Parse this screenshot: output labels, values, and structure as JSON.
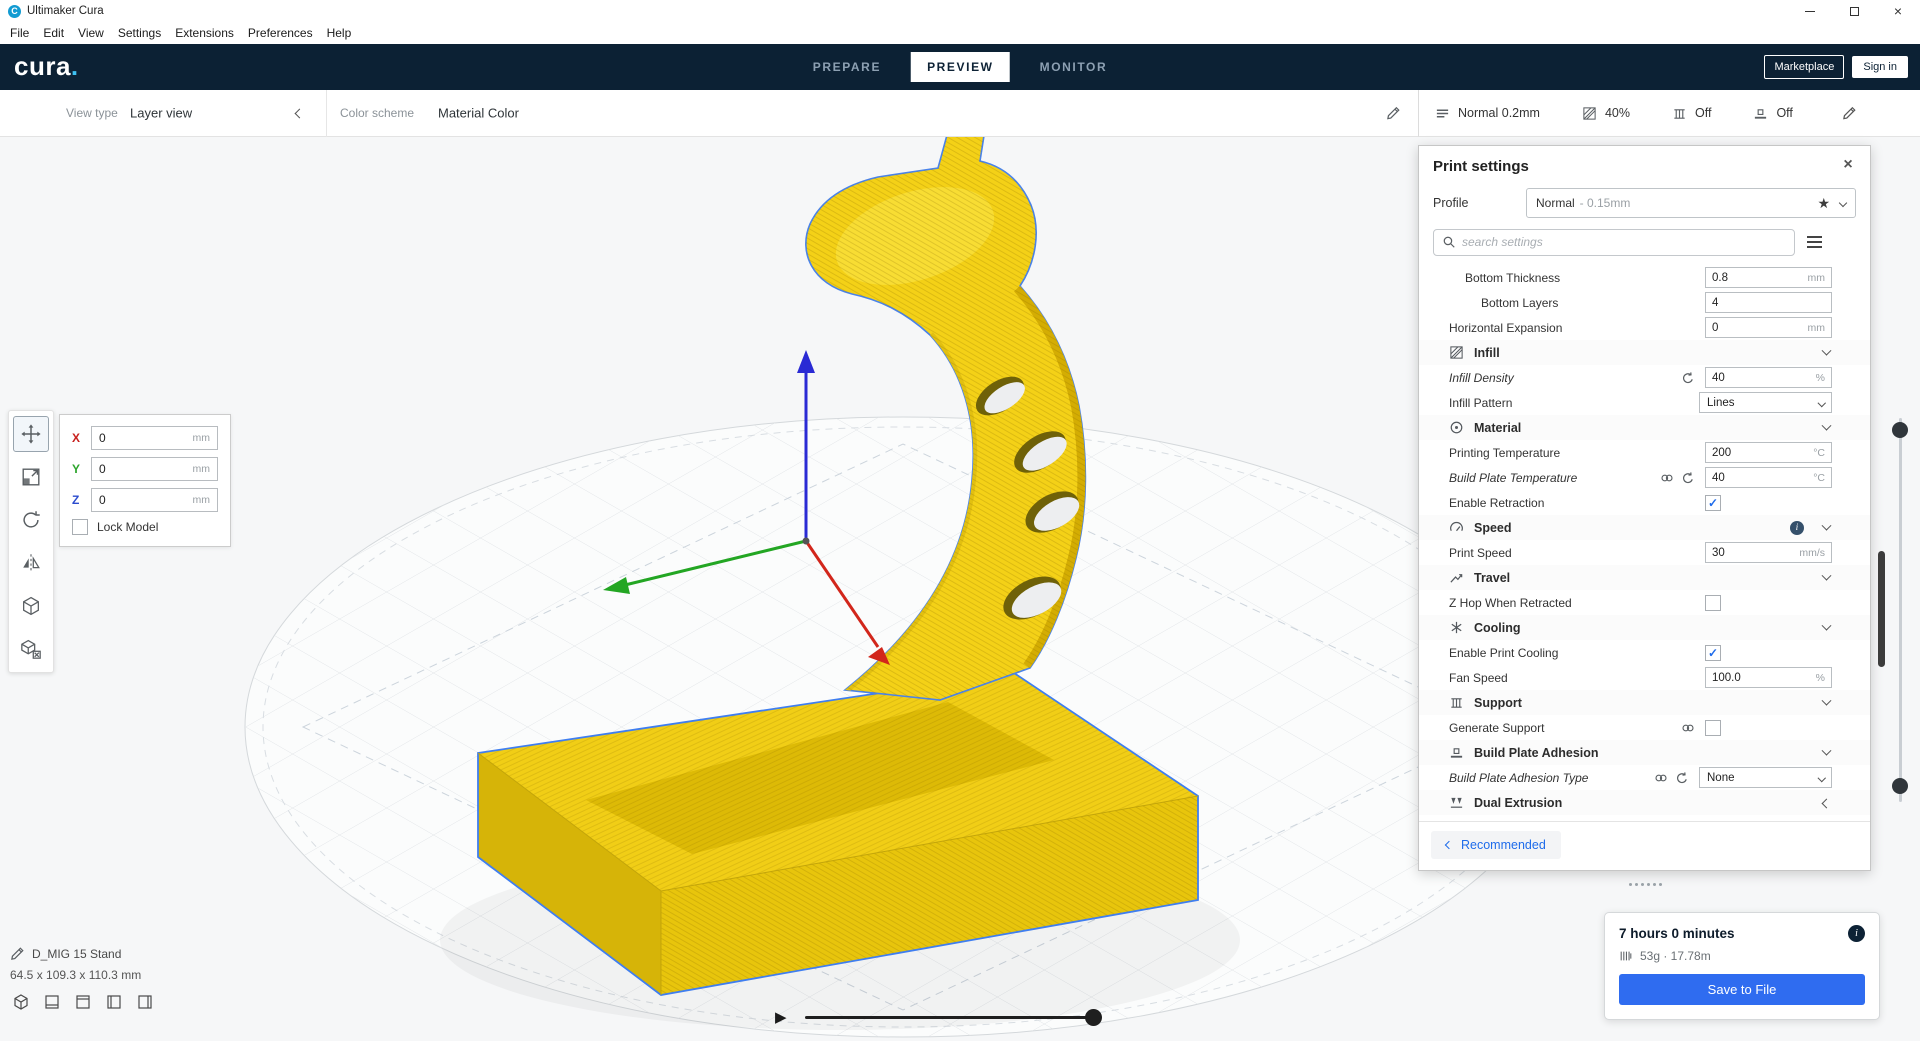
{
  "window": {
    "title": "Ultimaker Cura"
  },
  "glyphs": {
    "close": "×",
    "star": "★",
    "check": "✓",
    "app_initial": "C"
  },
  "menu": {
    "items": [
      "File",
      "Edit",
      "View",
      "Settings",
      "Extensions",
      "Preferences",
      "Help"
    ]
  },
  "header": {
    "logo": "cura",
    "logo_dot": ".",
    "tabs": [
      {
        "label": "PREPARE",
        "active": false
      },
      {
        "label": "PREVIEW",
        "active": true
      },
      {
        "label": "MONITOR",
        "active": false
      }
    ],
    "marketplace_label": "Marketplace",
    "sign_in_label": "Sign in"
  },
  "stage_header": {
    "view_type_label": "View type",
    "view_type_value": "Layer view",
    "color_scheme_label": "Color scheme",
    "color_scheme_value": "Material Color"
  },
  "settings_summary": {
    "items": [
      {
        "name": "profile",
        "icon": "layers",
        "text": "Normal 0.2mm"
      },
      {
        "name": "infill",
        "icon": "infill",
        "text": "40%"
      },
      {
        "name": "support",
        "icon": "support",
        "text": "Off"
      },
      {
        "name": "adhesion",
        "icon": "adhesion",
        "text": "Off"
      }
    ]
  },
  "print_settings": {
    "title": "Print settings",
    "profile_label": "Profile",
    "profile_value": "Normal",
    "profile_suffix": "- 0.15mm",
    "search_placeholder": "search settings",
    "footer_label": "Recommended",
    "rows": [
      {
        "type": "setting",
        "label": "Bottom Thickness",
        "indent": 1,
        "control": "number",
        "value": "0.8",
        "unit": "mm"
      },
      {
        "type": "setting",
        "label": "Bottom Layers",
        "indent": 2,
        "control": "number",
        "value": "4",
        "unit": ""
      },
      {
        "type": "setting",
        "label": "Horizontal Expansion",
        "indent": 0,
        "control": "number",
        "value": "0",
        "unit": "mm"
      },
      {
        "type": "category",
        "label": "Infill",
        "icon": "infill",
        "chevron": "down"
      },
      {
        "type": "setting",
        "label": "Infill Density",
        "indent": 0,
        "italic": true,
        "reset": true,
        "control": "number",
        "value": "40",
        "unit": "%"
      },
      {
        "type": "setting",
        "label": "Infill Pattern",
        "indent": 0,
        "control": "select",
        "value": "Lines"
      },
      {
        "type": "category",
        "label": "Material",
        "icon": "material",
        "chevron": "down"
      },
      {
        "type": "setting",
        "label": "Printing Temperature",
        "indent": 0,
        "control": "number",
        "value": "200",
        "unit": "°C"
      },
      {
        "type": "setting",
        "label": "Build Plate Temperature",
        "indent": 0,
        "italic": true,
        "link": true,
        "reset": true,
        "control": "number",
        "value": "40",
        "unit": "°C"
      },
      {
        "type": "setting",
        "label": "Enable Retraction",
        "indent": 0,
        "control": "checkbox",
        "checked": true
      },
      {
        "type": "category",
        "label": "Speed",
        "icon": "speed",
        "chevron": "down",
        "info": true
      },
      {
        "type": "setting",
        "label": "Print Speed",
        "indent": 0,
        "control": "number",
        "value": "30",
        "unit": "mm/s"
      },
      {
        "type": "category",
        "label": "Travel",
        "icon": "travel",
        "chevron": "down"
      },
      {
        "type": "setting",
        "label": "Z Hop When Retracted",
        "indent": 0,
        "control": "checkbox",
        "checked": false
      },
      {
        "type": "category",
        "label": "Cooling",
        "icon": "cooling",
        "chevron": "down"
      },
      {
        "type": "setting",
        "label": "Enable Print Cooling",
        "indent": 0,
        "control": "checkbox",
        "checked": true
      },
      {
        "type": "setting",
        "label": "Fan Speed",
        "indent": 0,
        "control": "number",
        "value": "100.0",
        "unit": "%"
      },
      {
        "type": "category",
        "label": "Support",
        "icon": "support",
        "chevron": "down"
      },
      {
        "type": "setting",
        "label": "Generate Support",
        "indent": 0,
        "link": true,
        "control": "checkbox",
        "checked": false
      },
      {
        "type": "category",
        "label": "Build Plate Adhesion",
        "icon": "adhesion",
        "chevron": "down"
      },
      {
        "type": "setting",
        "label": "Build Plate Adhesion Type",
        "indent": 0,
        "italic": true,
        "link": true,
        "reset": true,
        "control": "select",
        "value": "None"
      },
      {
        "type": "category",
        "label": "Dual Extrusion",
        "icon": "dual",
        "chevron": "left"
      }
    ]
  },
  "toolbar": {
    "tools": [
      {
        "name": "move",
        "icon": "move",
        "selected": true
      },
      {
        "name": "scale",
        "icon": "scale",
        "selected": false
      },
      {
        "name": "rotate",
        "icon": "rotate",
        "selected": false
      },
      {
        "name": "mirror",
        "icon": "mirror",
        "selected": false
      },
      {
        "name": "per-model-settings",
        "icon": "permodel",
        "selected": false
      },
      {
        "name": "support-blocker",
        "icon": "blocker",
        "selected": false
      }
    ]
  },
  "position_panel": {
    "axes": [
      {
        "label": "X",
        "value": "0",
        "unit": "mm",
        "color": "#c8201d"
      },
      {
        "label": "Y",
        "value": "0",
        "unit": "mm",
        "color": "#2ca52c"
      },
      {
        "label": "Z",
        "value": "0",
        "unit": "mm",
        "color": "#2b4bcd"
      }
    ],
    "lock_label": "Lock Model"
  },
  "model_info": {
    "name": "D_MIG 15 Stand",
    "dimensions": "64.5 x 109.3 x 110.3 mm"
  },
  "viewport_controls": {
    "play_glyph": "▶",
    "view_icons": [
      "view-3d",
      "view-front",
      "view-top",
      "view-left",
      "view-right"
    ]
  },
  "output": {
    "time": "7 hours 0 minutes",
    "material_usage": "53g · 17.78m",
    "save_label": "Save to File"
  }
}
